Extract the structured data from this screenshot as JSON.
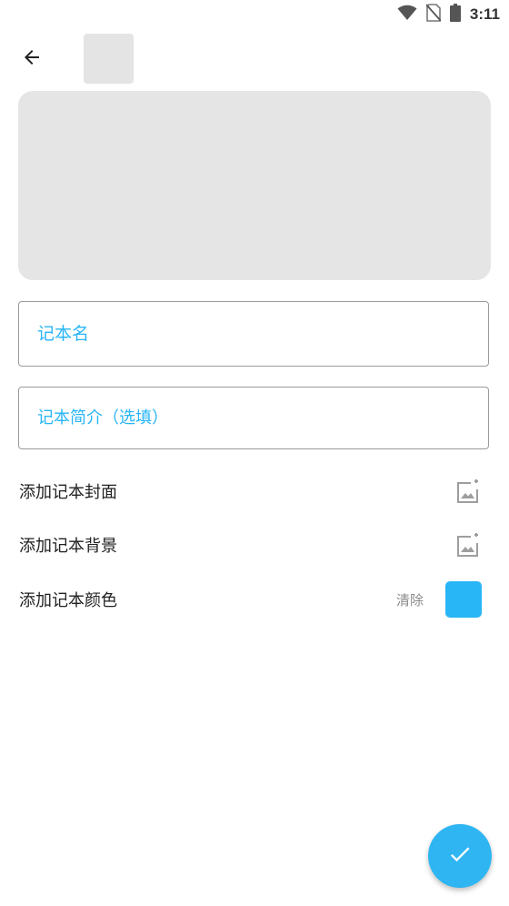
{
  "status_bar": {
    "time": "3:11",
    "icons": [
      "wifi-icon",
      "no-sim-icon",
      "battery-icon"
    ]
  },
  "toolbar": {
    "back_icon": "arrow-left-icon"
  },
  "form": {
    "name_placeholder": "记本名",
    "intro_placeholder": "记本简介（选填）"
  },
  "options": {
    "cover_label": "添加记本封面",
    "cover_icon": "add-image-icon",
    "background_label": "添加记本背景",
    "background_icon": "add-image-icon",
    "color_label": "添加记本颜色",
    "clear_label": "清除"
  },
  "fab": {
    "icon": "check-icon"
  },
  "colors": {
    "accent": "#29b6f6",
    "placeholder_gray": "#e5e5e5",
    "fab": "#2fb5f2",
    "swatch": "#29b6f6"
  }
}
